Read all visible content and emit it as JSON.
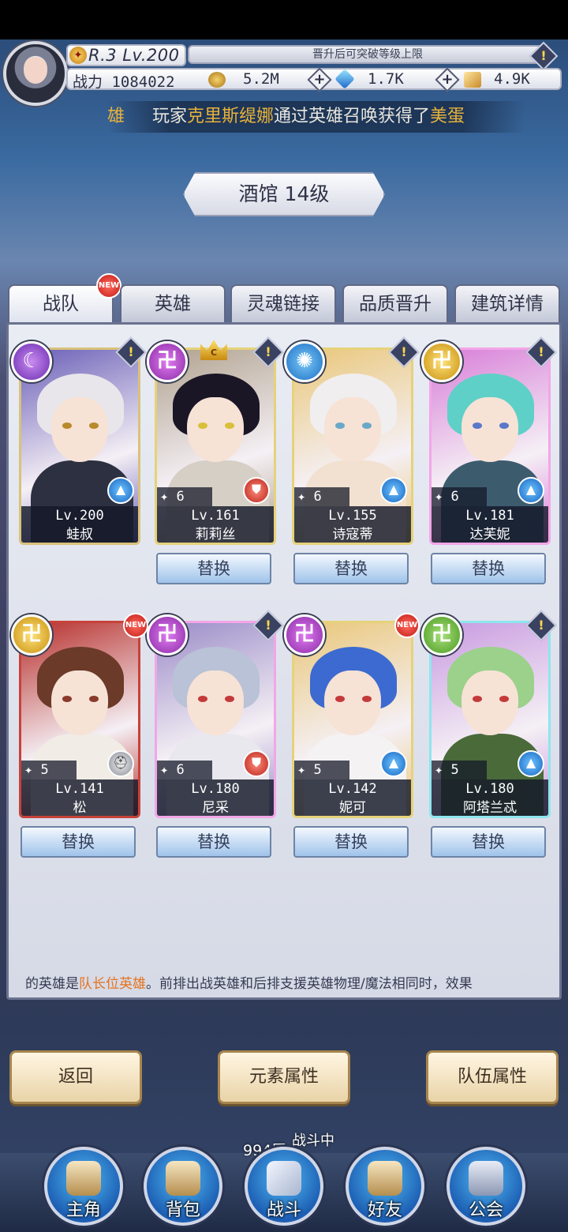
{
  "player": {
    "rank_level": "R.3 Lv.200",
    "exp_hint": "晋升后可突破等级上限",
    "power_label": "战力 1084022"
  },
  "resources": {
    "gold": "5.2M",
    "gems": "1.7K",
    "scrolls": "4.9K"
  },
  "ticker": {
    "prefix": "雄",
    "text_before": "玩家",
    "player": "克里斯缇娜",
    "text_middle": "通过英雄召唤获得了",
    "item": "美蛋"
  },
  "building_title": "酒馆 14级",
  "tabs": [
    {
      "label": "战队"
    },
    {
      "label": "英雄"
    },
    {
      "label": "灵魂链接"
    },
    {
      "label": "品质晋升"
    },
    {
      "label": "建筑详情"
    }
  ],
  "badges": {
    "new": "NEW",
    "alert": "!",
    "crown": "C"
  },
  "heroes": [
    {
      "name": "蛙叔",
      "level": "Lv.200",
      "stars": "",
      "element": "moon",
      "role": "mage",
      "colors": {
        "hair": "#e8e6ea",
        "body": "#2c3040",
        "bg": "#6a5fb8",
        "eye": "#b88a2a",
        "border": "#d9c27a"
      }
    },
    {
      "name": "莉莉丝",
      "level": "Lv.161",
      "stars": "6",
      "element": "dark",
      "role": "warrior",
      "colors": {
        "hair": "#1a1626",
        "body": "#d6cfc5",
        "bg": "#b0a28e",
        "eye": "#d8c03a",
        "border": "#e6d27a"
      }
    },
    {
      "name": "诗寇蒂",
      "level": "Lv.155",
      "stars": "6",
      "element": "wind",
      "role": "mage",
      "colors": {
        "hair": "#f1eef0",
        "body": "#f2e1d0",
        "bg": "#e9c77a",
        "eye": "#6aa8c8",
        "border": "#e6d27a"
      }
    },
    {
      "name": "达芙妮",
      "level": "Lv.181",
      "stars": "6",
      "element": "light",
      "role": "mage",
      "colors": {
        "hair": "#5ed0c8",
        "body": "#3c5c6e",
        "bg": "#d87ed8",
        "eye": "#5a78c8",
        "border": "#f3a6e8"
      }
    },
    {
      "name": "松",
      "level": "Lv.141",
      "stars": "5",
      "element": "light",
      "role": "tank",
      "colors": {
        "hair": "#6b3a28",
        "body": "#f1ece6",
        "bg": "#b7302c",
        "eye": "#8a3a2a",
        "border": "#c7423a"
      }
    },
    {
      "name": "尼采",
      "level": "Lv.180",
      "stars": "6",
      "element": "dark",
      "role": "warrior",
      "colors": {
        "hair": "#b9c2d6",
        "body": "#e8e8ee",
        "bg": "#9b8cc8",
        "eye": "#c43a3a",
        "border": "#f3a6e8"
      }
    },
    {
      "name": "妮可",
      "level": "Lv.142",
      "stars": "5",
      "element": "dark",
      "role": "mage",
      "colors": {
        "hair": "#3c6ad0",
        "body": "#f5f2f4",
        "bg": "#e9c77a",
        "eye": "#c43a3a",
        "border": "#e6d27a"
      }
    },
    {
      "name": "阿塔兰忒",
      "level": "Lv.180",
      "stars": "5",
      "element": "nature",
      "role": "mage",
      "colors": {
        "hair": "#9bd18a",
        "body": "#4a6a3a",
        "bg": "#c89ae0",
        "eye": "#c43a3a",
        "border": "#8ee6ee"
      }
    }
  ],
  "swap_label": "替换",
  "hint": {
    "before": "的英雄是",
    "highlight": "队长位英雄",
    "after": "。前排出战英雄和后排支援英雄物理/魔法相同时，效果"
  },
  "buttons": {
    "back": "返回",
    "element_attr": "元素属性",
    "team_attr": "队伍属性"
  },
  "battle_status": {
    "floor": "994层",
    "state": "战斗中"
  },
  "nav": [
    {
      "label": "主角"
    },
    {
      "label": "背包"
    },
    {
      "label": "战斗"
    },
    {
      "label": "好友"
    },
    {
      "label": "公会"
    }
  ]
}
